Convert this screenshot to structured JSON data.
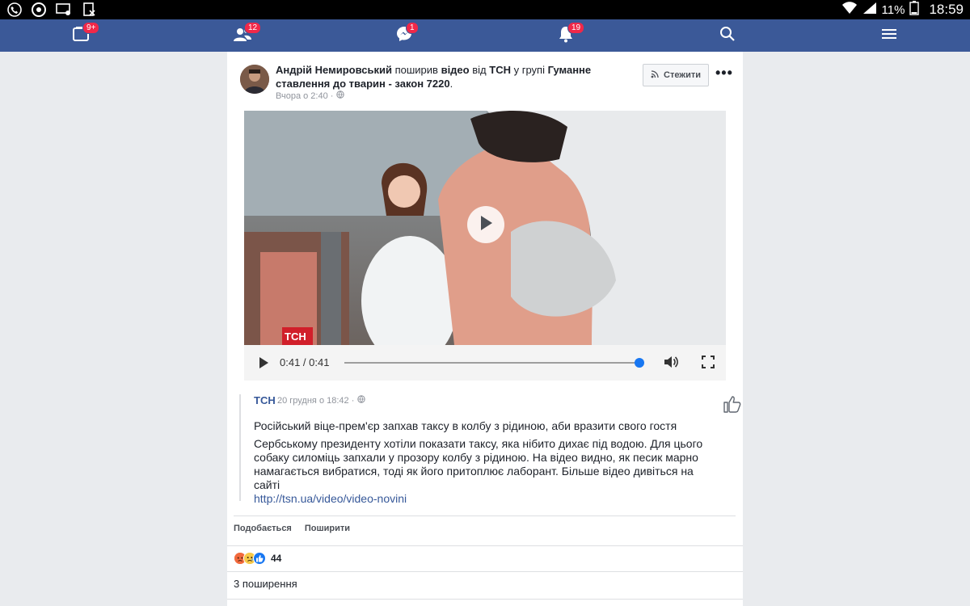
{
  "status_bar": {
    "battery": "11%",
    "time": "18:59"
  },
  "nav": {
    "badges": {
      "feed": "9+",
      "friends": "12",
      "messages": "1",
      "notifications": "19"
    }
  },
  "post": {
    "author": "Андрій Немировський",
    "shared_text": "поширив",
    "video_word": "відео",
    "from_text": "від",
    "source": "ТСН",
    "in_group_text": "у групі",
    "group": "Гуманне ставлення до тварин - закон 7220",
    "period": ".",
    "timestamp": "Вчора о 2:40 ·",
    "follow_label": "Стежити",
    "more_label": "•••"
  },
  "video": {
    "time_display": "0:41 / 0:41",
    "progress": 1.0,
    "watermark": "ТСН"
  },
  "attachment": {
    "author": "ТСН",
    "timestamp": "20 грудня о 18:42 ·",
    "title": "Російський віце-прем'єр запхав таксу в колбу з рідиною, аби вразити свого гостя",
    "body": "Сербському президенту хотіли показати таксу, яка нібито дихає під водою. Для цього собаку силоміць запхали у прозору колбу з рідиною. На відео видно, як песик марно намагається вибратися, тоді як його притоплює лаборант. Більше відео дивіться на сайті",
    "link": "http://tsn.ua/video/video-novini"
  },
  "actions": {
    "like_label": "Подобається",
    "share_label": "Поширити"
  },
  "reactions": {
    "count": "44",
    "types": [
      "angry",
      "sad",
      "like"
    ]
  },
  "shares_text": "3 поширення",
  "colors": {
    "fb_blue": "#3b5998",
    "badge_red": "#f02849",
    "link_blue": "#365899"
  }
}
